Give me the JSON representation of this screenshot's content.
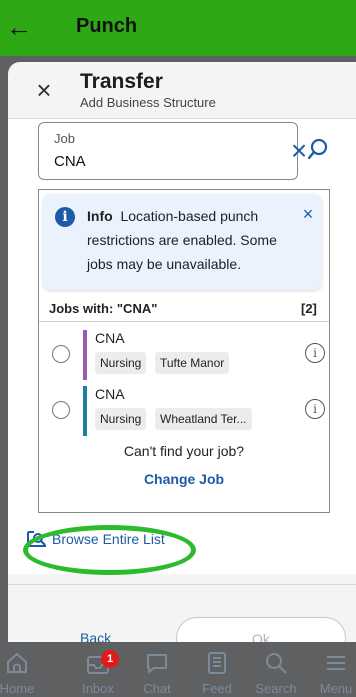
{
  "appbar": {
    "title": "Punch",
    "back_icon": "arrow-left-icon"
  },
  "sheet": {
    "title": "Transfer",
    "subtitle": "Add Business Structure"
  },
  "job_field": {
    "label": "Job",
    "value": "CNA"
  },
  "info": {
    "title": "Info",
    "message": "Location-based punch restrictions are enabled. Some jobs may be unavailable."
  },
  "jobs": {
    "header": "Jobs with: \"CNA\"",
    "count": "[2]",
    "items": [
      {
        "name": "CNA",
        "chips": [
          "Nursing",
          "Tufte Manor"
        ],
        "color": "#9b59b6"
      },
      {
        "name": "CNA",
        "chips": [
          "Nursing",
          "Wheatland Ter..."
        ],
        "color": "#1a7fa1"
      }
    ]
  },
  "not_found": {
    "prompt": "Can't find your job?",
    "link": "Change Job"
  },
  "browse": {
    "label": "Browse Entire List"
  },
  "buttons": {
    "back": "Back",
    "ok": "Ok"
  },
  "nav": {
    "items": [
      {
        "label": "Home",
        "icon": "home-icon"
      },
      {
        "label": "Inbox",
        "icon": "inbox-icon",
        "badge": "1"
      },
      {
        "label": "Chat",
        "icon": "chat-icon"
      },
      {
        "label": "Feed",
        "icon": "feed-icon"
      },
      {
        "label": "Search",
        "icon": "search-icon"
      },
      {
        "label": "Menu",
        "icon": "menu-icon"
      }
    ]
  },
  "colors": {
    "appbar": "#2fa816",
    "accent": "#1d5ba6",
    "highlight": "#2cbb2c"
  }
}
